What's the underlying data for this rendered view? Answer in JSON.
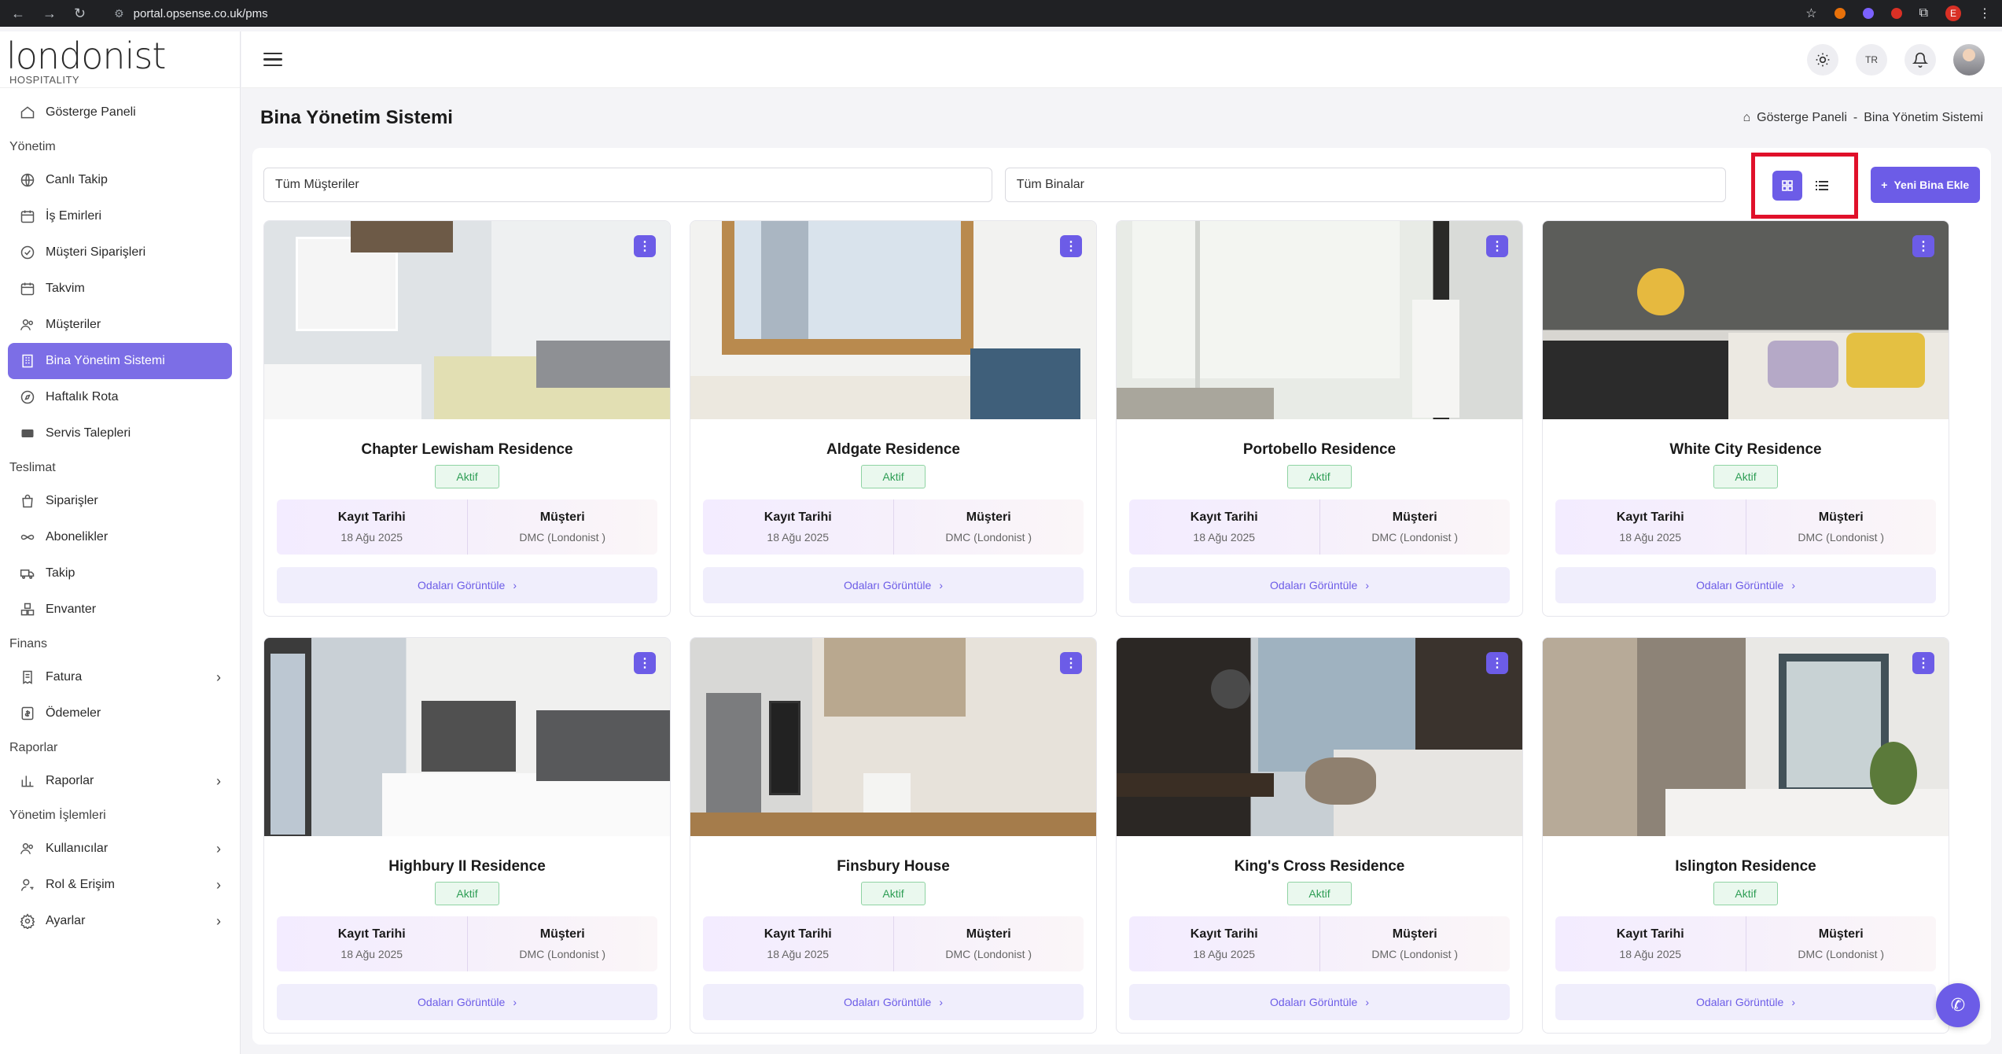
{
  "browser": {
    "url": "portal.opsense.co.uk/pms",
    "profile_initial": "E"
  },
  "brand": {
    "logo_text": "londonist",
    "logo_sub": "HOSPITALITY"
  },
  "sidebar": {
    "items": [
      {
        "type": "item",
        "label": "Gösterge Paneli",
        "icon": "home-icon"
      },
      {
        "type": "section",
        "label": "Yönetim"
      },
      {
        "type": "item",
        "label": "Canlı Takip",
        "icon": "globe-icon"
      },
      {
        "type": "item",
        "label": "İş Emirleri",
        "icon": "calendar-icon"
      },
      {
        "type": "item",
        "label": "Müşteri Siparişleri",
        "icon": "check-circle-icon"
      },
      {
        "type": "item",
        "label": "Takvim",
        "icon": "calendar-icon"
      },
      {
        "type": "item",
        "label": "Müşteriler",
        "icon": "users-icon"
      },
      {
        "type": "item",
        "label": "Bina Yönetim Sistemi",
        "icon": "building-icon",
        "active": true
      },
      {
        "type": "item",
        "label": "Haftalık Rota",
        "icon": "compass-icon"
      },
      {
        "type": "item",
        "label": "Servis Talepleri",
        "icon": "ticket-icon"
      },
      {
        "type": "section",
        "label": "Teslimat"
      },
      {
        "type": "item",
        "label": "Siparişler",
        "icon": "bag-icon"
      },
      {
        "type": "item",
        "label": "Abonelikler",
        "icon": "infinity-icon"
      },
      {
        "type": "item",
        "label": "Takip",
        "icon": "truck-icon"
      },
      {
        "type": "item",
        "label": "Envanter",
        "icon": "boxes-icon"
      },
      {
        "type": "section",
        "label": "Finans"
      },
      {
        "type": "item",
        "label": "Fatura",
        "icon": "invoice-icon",
        "chevron": true
      },
      {
        "type": "item",
        "label": "Ödemeler",
        "icon": "payment-icon"
      },
      {
        "type": "section",
        "label": "Raporlar"
      },
      {
        "type": "item",
        "label": "Raporlar",
        "icon": "chart-icon",
        "chevron": true
      },
      {
        "type": "section",
        "label": "Yönetim İşlemleri"
      },
      {
        "type": "item",
        "label": "Kullanıcılar",
        "icon": "users-icon",
        "chevron": true
      },
      {
        "type": "item",
        "label": "Rol & Erişim",
        "icon": "user-key-icon",
        "chevron": true
      },
      {
        "type": "item",
        "label": "Ayarlar",
        "icon": "gear-icon",
        "chevron": true
      }
    ]
  },
  "topbar": {
    "lang": "TR"
  },
  "page": {
    "title": "Bina Yönetim Sistemi",
    "breadcrumb_home": "Gösterge Paneli",
    "breadcrumb_sep": "-",
    "breadcrumb_current": "Bina Yönetim Sistemi"
  },
  "filters": {
    "customers_value": "Tüm Müşteriler",
    "buildings_value": "Tüm Binalar",
    "add_button": "Yeni Bina Ekle"
  },
  "card_labels": {
    "status": "Aktif",
    "date_label": "Kayıt Tarihi",
    "customer_label": "Müşteri",
    "rooms_button": "Odaları Görüntüle"
  },
  "buildings": [
    {
      "name": "Chapter Lewisham Residence",
      "date": "18 Ağu 2025",
      "customer": "DMC (Londonist )",
      "scene": "a"
    },
    {
      "name": "Aldgate Residence",
      "date": "18 Ağu 2025",
      "customer": "DMC (Londonist )",
      "scene": "b"
    },
    {
      "name": "Portobello Residence",
      "date": "18 Ağu 2025",
      "customer": "DMC (Londonist )",
      "scene": "c"
    },
    {
      "name": "White City Residence",
      "date": "18 Ağu 2025",
      "customer": "DMC (Londonist )",
      "scene": "d"
    },
    {
      "name": "Highbury II Residence",
      "date": "18 Ağu 2025",
      "customer": "DMC (Londonist )",
      "scene": "e"
    },
    {
      "name": "Finsbury House",
      "date": "18 Ağu 2025",
      "customer": "DMC (Londonist )",
      "scene": "f"
    },
    {
      "name": "King's Cross Residence",
      "date": "18 Ağu 2025",
      "customer": "DMC (Londonist )",
      "scene": "g"
    },
    {
      "name": "Islington Residence",
      "date": "18 Ağu 2025",
      "customer": "DMC (Londonist )",
      "scene": "h"
    }
  ],
  "colors": {
    "accent": "#6c5ce7",
    "active_item": "#7c6ee6",
    "status_green": "#2e9e55",
    "highlight_box": "#e0102a"
  }
}
